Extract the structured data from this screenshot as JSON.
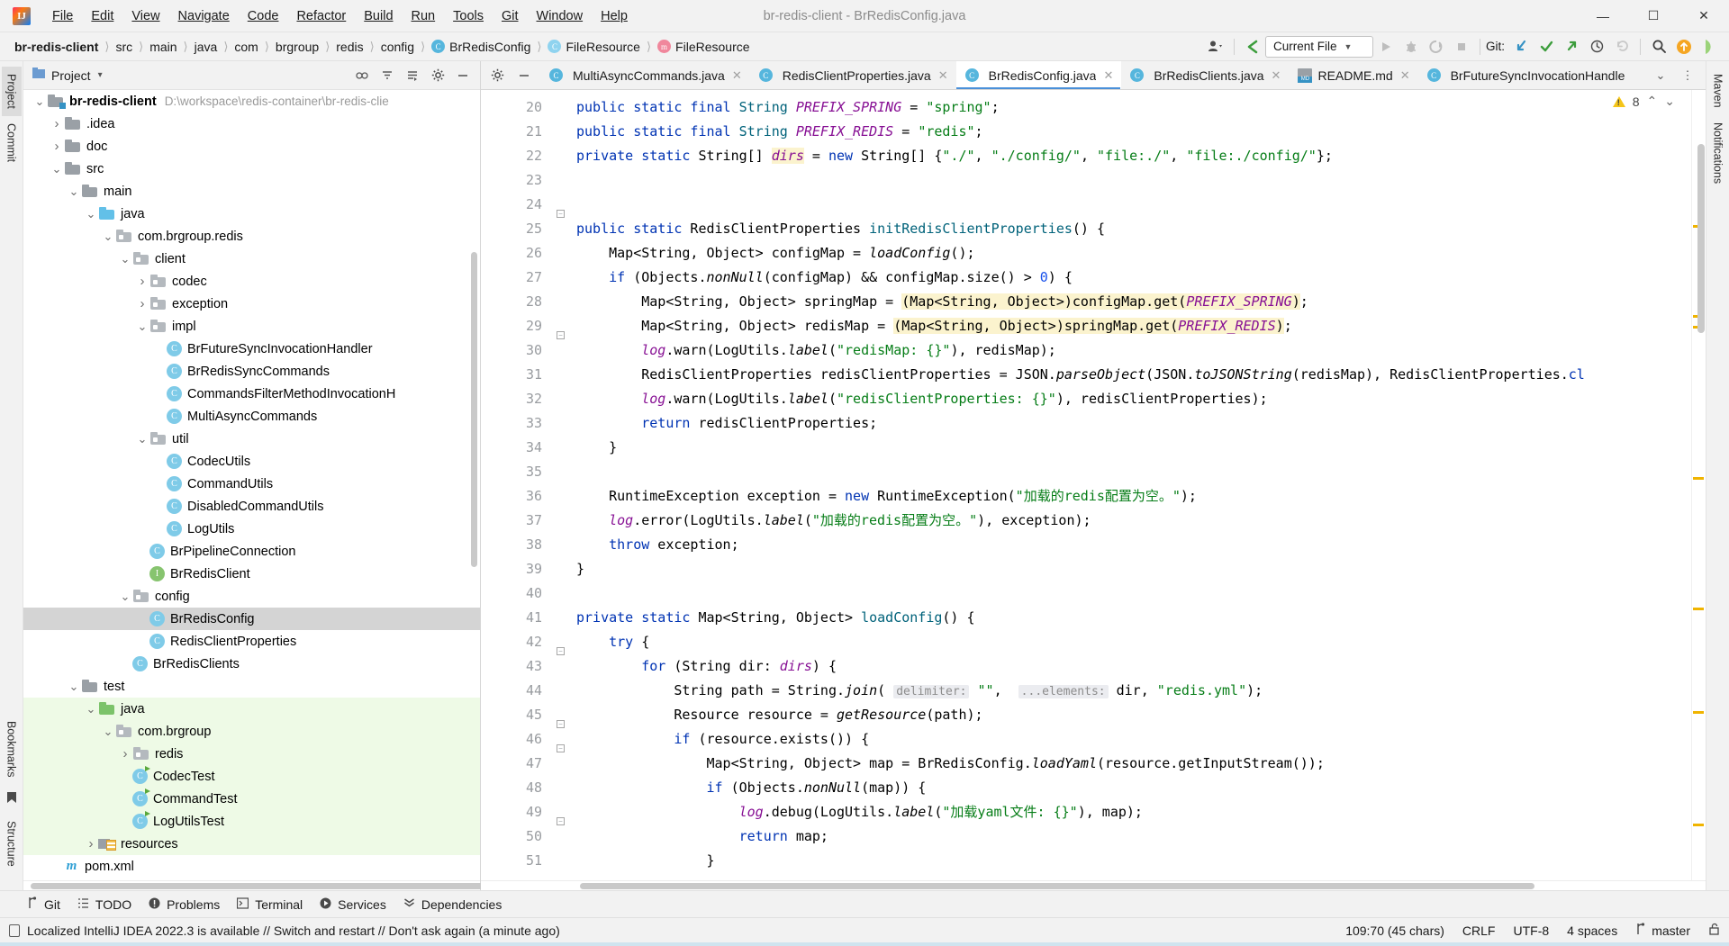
{
  "window": {
    "title": "br-redis-client - BrRedisConfig.java",
    "logo_text": "IJ",
    "controls": {
      "minimize": "—",
      "maximize": "☐",
      "close": "✕"
    }
  },
  "menu": [
    {
      "label": "File"
    },
    {
      "label": "Edit"
    },
    {
      "label": "View"
    },
    {
      "label": "Navigate"
    },
    {
      "label": "Code"
    },
    {
      "label": "Refactor"
    },
    {
      "label": "Build"
    },
    {
      "label": "Run"
    },
    {
      "label": "Tools"
    },
    {
      "label": "Git"
    },
    {
      "label": "Window"
    },
    {
      "label": "Help"
    }
  ],
  "breadcrumbs": [
    {
      "label": "br-redis-client",
      "bold": true,
      "icon": ""
    },
    {
      "label": "src",
      "icon": ""
    },
    {
      "label": "main",
      "icon": ""
    },
    {
      "label": "java",
      "icon": ""
    },
    {
      "label": "com",
      "icon": ""
    },
    {
      "label": "brgroup",
      "icon": ""
    },
    {
      "label": "redis",
      "icon": ""
    },
    {
      "label": "config",
      "icon": ""
    },
    {
      "label": "BrRedisConfig",
      "icon": "class-icon",
      "glyph": "C"
    },
    {
      "label": "FileResource",
      "icon": "class-icon",
      "glyph": "C"
    },
    {
      "label": "FileResource",
      "icon": "method-icon",
      "glyph": "m"
    }
  ],
  "toolbar": {
    "user_icon": "user-silhouette-icon",
    "back_icon": "back-arrow-icon",
    "run_config": "Current File",
    "run_icon": "run-play-icon",
    "debug_icon": "debug-bug-icon",
    "coverage_icon": "run-coverage-icon",
    "stop_icon": "stop-square-icon",
    "git_label": "Git:",
    "update_icon": "git-update-icon",
    "commit_icon": "git-commit-check-icon",
    "push_icon": "git-push-icon",
    "history_icon": "git-history-icon",
    "rollback_icon": "git-rollback-icon",
    "search_icon": "search-icon",
    "updates_icon": "updates-available-icon",
    "ide_icon": "ide-assistant-icon"
  },
  "left_strip": [
    {
      "label": "Project",
      "selected": true
    },
    {
      "label": "Commit",
      "selected": false
    },
    {
      "label": "Bookmarks",
      "selected": false
    },
    {
      "label": "Structure",
      "selected": false
    }
  ],
  "right_strip": [
    {
      "label": "Maven"
    },
    {
      "label": "Notifications"
    }
  ],
  "project_panel": {
    "title": "Project",
    "chevron": "▾",
    "icons": [
      "collapse-all-icon",
      "expand-all-icon",
      "select-opened-file-icon",
      "settings-gear-icon",
      "hide-icon"
    ],
    "tree": [
      {
        "depth": 0,
        "arrow": "down",
        "icon": "module-folder",
        "label": "br-redis-client",
        "bold": true,
        "path": "D:\\workspace\\redis-container\\br-redis-clie"
      },
      {
        "depth": 1,
        "arrow": "right",
        "icon": "folder",
        "label": ".idea"
      },
      {
        "depth": 1,
        "arrow": "right",
        "icon": "folder",
        "label": "doc"
      },
      {
        "depth": 1,
        "arrow": "down",
        "icon": "folder",
        "label": "src"
      },
      {
        "depth": 2,
        "arrow": "down",
        "icon": "folder",
        "label": "main"
      },
      {
        "depth": 3,
        "arrow": "down",
        "icon": "folder-blue",
        "label": "java"
      },
      {
        "depth": 4,
        "arrow": "down",
        "icon": "package",
        "label": "com.brgroup.redis"
      },
      {
        "depth": 5,
        "arrow": "down",
        "icon": "package",
        "label": "client"
      },
      {
        "depth": 6,
        "arrow": "right",
        "icon": "package",
        "label": "codec"
      },
      {
        "depth": 6,
        "arrow": "right",
        "icon": "package",
        "label": "exception"
      },
      {
        "depth": 6,
        "arrow": "down",
        "icon": "package",
        "label": "impl"
      },
      {
        "depth": 7,
        "arrow": "none",
        "icon": "class",
        "label": "BrFutureSyncInvocationHandler"
      },
      {
        "depth": 7,
        "arrow": "none",
        "icon": "class",
        "label": "BrRedisSyncCommands"
      },
      {
        "depth": 7,
        "arrow": "none",
        "icon": "class",
        "label": "CommandsFilterMethodInvocationH"
      },
      {
        "depth": 7,
        "arrow": "none",
        "icon": "class",
        "label": "MultiAsyncCommands"
      },
      {
        "depth": 6,
        "arrow": "down",
        "icon": "package",
        "label": "util"
      },
      {
        "depth": 7,
        "arrow": "none",
        "icon": "class",
        "label": "CodecUtils"
      },
      {
        "depth": 7,
        "arrow": "none",
        "icon": "class",
        "label": "CommandUtils"
      },
      {
        "depth": 7,
        "arrow": "none",
        "icon": "class",
        "label": "DisabledCommandUtils"
      },
      {
        "depth": 7,
        "arrow": "none",
        "icon": "class",
        "label": "LogUtils"
      },
      {
        "depth": 6,
        "arrow": "none",
        "icon": "class",
        "label": "BrPipelineConnection"
      },
      {
        "depth": 6,
        "arrow": "none",
        "icon": "interface",
        "label": "BrRedisClient"
      },
      {
        "depth": 5,
        "arrow": "down",
        "icon": "package",
        "label": "config"
      },
      {
        "depth": 6,
        "arrow": "none",
        "icon": "class",
        "label": "BrRedisConfig",
        "selected": true
      },
      {
        "depth": 6,
        "arrow": "none",
        "icon": "class",
        "label": "RedisClientProperties"
      },
      {
        "depth": 5,
        "arrow": "none",
        "icon": "class",
        "label": "BrRedisClients"
      },
      {
        "depth": 2,
        "arrow": "down",
        "icon": "folder",
        "label": "test"
      },
      {
        "depth": 3,
        "arrow": "down",
        "icon": "folder-green",
        "label": "java",
        "test": true
      },
      {
        "depth": 4,
        "arrow": "down",
        "icon": "package",
        "label": "com.brgroup",
        "test": true
      },
      {
        "depth": 5,
        "arrow": "right",
        "icon": "package",
        "label": "redis",
        "test": true
      },
      {
        "depth": 5,
        "arrow": "none",
        "icon": "class-test",
        "label": "CodecTest",
        "test": true
      },
      {
        "depth": 5,
        "arrow": "none",
        "icon": "class-test",
        "label": "CommandTest",
        "test": true
      },
      {
        "depth": 5,
        "arrow": "none",
        "icon": "class-test",
        "label": "LogUtilsTest",
        "test": true
      },
      {
        "depth": 3,
        "arrow": "right",
        "icon": "resources",
        "label": "resources",
        "test": true
      },
      {
        "depth": 1,
        "arrow": "none",
        "icon": "maven",
        "label": "pom.xml"
      }
    ]
  },
  "editor_tabs": [
    {
      "label": "MultiAsyncCommands.java",
      "icon": "class-icon",
      "active": false
    },
    {
      "label": "RedisClientProperties.java",
      "icon": "class-icon",
      "active": false
    },
    {
      "label": "BrRedisConfig.java",
      "icon": "class-icon",
      "active": true
    },
    {
      "label": "BrRedisClients.java",
      "icon": "class-icon",
      "active": false
    },
    {
      "label": "README.md",
      "icon": "markdown-icon",
      "active": false
    },
    {
      "label": "BrFutureSyncInvocationHandle",
      "icon": "class-icon",
      "active": false
    }
  ],
  "tabbar_right": {
    "chevron": "⌄",
    "more": "⋮"
  },
  "editor": {
    "first_line": 20,
    "warning_count": "8",
    "warning_icon": "warning-triangle-icon",
    "prev_icon": "⌃",
    "next_icon": "⌄",
    "lines": [
      {
        "n": 20,
        "text": "public static final String PREFIX_SPRING = \"spring\";"
      },
      {
        "n": 21,
        "text": "public static final String PREFIX_REDIS = \"redis\";"
      },
      {
        "n": 22,
        "text": "private static String[] dirs = new String[] {\"./\", \"./config/\", \"file:./\", \"file:./config/\"};"
      },
      {
        "n": 23,
        "text": ""
      },
      {
        "n": 24,
        "text": ""
      },
      {
        "n": 25,
        "text": "public static RedisClientProperties initRedisClientProperties() {"
      },
      {
        "n": 26,
        "text": "    Map<String, Object> configMap = loadConfig();"
      },
      {
        "n": 27,
        "text": "    if (Objects.nonNull(configMap) && configMap.size() > 0) {"
      },
      {
        "n": 28,
        "text": "        Map<String, Object> springMap = (Map<String, Object>)configMap.get(PREFIX_SPRING);"
      },
      {
        "n": 29,
        "text": "        Map<String, Object> redisMap = (Map<String, Object>)springMap.get(PREFIX_REDIS);"
      },
      {
        "n": 30,
        "text": "        log.warn(LogUtils.label(\"redisMap: {}\"), redisMap);"
      },
      {
        "n": 31,
        "text": "        RedisClientProperties redisClientProperties = JSON.parseObject(JSON.toJSONString(redisMap), RedisClientProperties.cl"
      },
      {
        "n": 32,
        "text": "        log.warn(LogUtils.label(\"redisClientProperties: {}\"), redisClientProperties);"
      },
      {
        "n": 33,
        "text": "        return redisClientProperties;"
      },
      {
        "n": 34,
        "text": "    }"
      },
      {
        "n": 35,
        "text": ""
      },
      {
        "n": 36,
        "text": "    RuntimeException exception = new RuntimeException(\"加载的redis配置为空。\");"
      },
      {
        "n": 37,
        "text": "    log.error(LogUtils.label(\"加载的redis配置为空。\"), exception);"
      },
      {
        "n": 38,
        "text": "    throw exception;"
      },
      {
        "n": 39,
        "text": "}"
      },
      {
        "n": 40,
        "text": ""
      },
      {
        "n": 41,
        "text": "private static Map<String, Object> loadConfig() {"
      },
      {
        "n": 42,
        "text": "    try {"
      },
      {
        "n": 43,
        "text": "        for (String dir: dirs) {"
      },
      {
        "n": 44,
        "text": "            String path = String.join( delimiter: \"\",  ...elements: dir, \"redis.yml\");"
      },
      {
        "n": 45,
        "text": "            Resource resource = getResource(path);"
      },
      {
        "n": 46,
        "text": "            if (resource.exists()) {"
      },
      {
        "n": 47,
        "text": "                Map<String, Object> map = BrRedisConfig.loadYaml(resource.getInputStream());"
      },
      {
        "n": 48,
        "text": "                if (Objects.nonNull(map)) {"
      },
      {
        "n": 49,
        "text": "                    log.debug(LogUtils.label(\"加载yaml文件: {}\"), map);"
      },
      {
        "n": 50,
        "text": "                    return map;"
      },
      {
        "n": 51,
        "text": "                }"
      }
    ]
  },
  "bottom_tools": [
    {
      "label": "Git",
      "icon": "git-branch-icon"
    },
    {
      "label": "TODO",
      "icon": "todo-list-icon"
    },
    {
      "label": "Problems",
      "icon": "problems-icon"
    },
    {
      "label": "Terminal",
      "icon": "terminal-icon"
    },
    {
      "label": "Services",
      "icon": "services-icon"
    },
    {
      "label": "Dependencies",
      "icon": "dependencies-icon"
    }
  ],
  "status": {
    "message_icon": "notification-icon",
    "message": "Localized IntelliJ IDEA 2022.3 is available // Switch and restart // Don't ask again (a minute ago)",
    "caret": "109:70 (45 chars)",
    "line_separator": "CRLF",
    "encoding": "UTF-8",
    "indent": "4 spaces",
    "branch": "master",
    "branch_icon": "git-branch-icon",
    "lock_icon": "lock-icon"
  },
  "colors": {
    "accent": "#4a90d9",
    "keyword": "#0033b3",
    "string": "#067d17",
    "field": "#871094",
    "method": "#00627a",
    "highlight": "#fbf3ce",
    "selection": "#d4d4d4",
    "test_bg": "#eefae6",
    "warning": "#f5c518"
  }
}
